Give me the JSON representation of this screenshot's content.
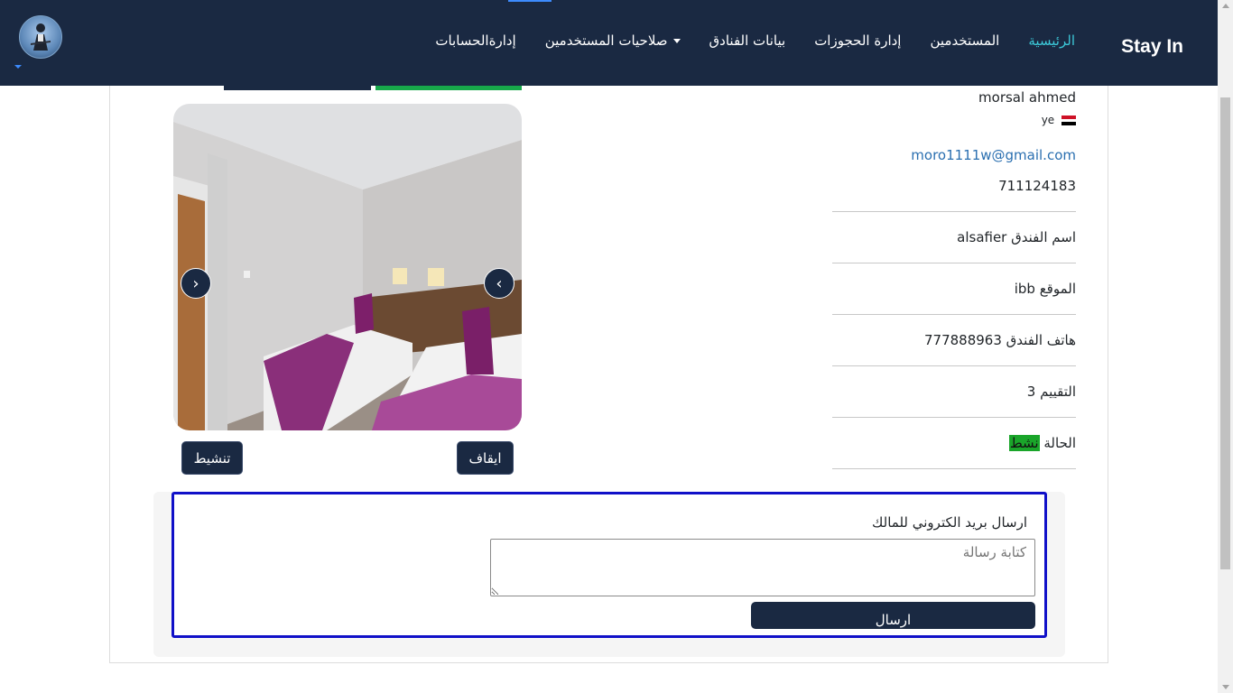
{
  "app": {
    "brand": "Stay In"
  },
  "nav": {
    "items": [
      {
        "label": "الرئيسية",
        "active": true
      },
      {
        "label": "المستخدمين"
      },
      {
        "label": "إدارة الحجوزات"
      },
      {
        "label": "بيانات الفنادق"
      },
      {
        "label": "صلاحيات المستخدمين",
        "dropdown": true
      },
      {
        "label": "إدارةالحسابات"
      }
    ]
  },
  "owner": {
    "name": "morsal ahmed",
    "country_code": "ye",
    "flag_icon": "yemen-flag-icon",
    "email": "moro1111w@gmail.com",
    "phone": "711124183"
  },
  "hotel": {
    "name_label": "اسم الفندق",
    "name": "alsafier",
    "location_label": "الموقع",
    "location": "ibb",
    "phone_label": "هاتف الفندق",
    "phone": "777888963",
    "rating_label": "التقييم",
    "rating": "3",
    "status_label": "الحالة",
    "status": "نشط"
  },
  "carousel": {
    "prev_label": "‹",
    "next_label": "›"
  },
  "actions": {
    "activate_label": "تنشيط",
    "suspend_label": "ايقاف"
  },
  "message": {
    "title": "ارسال بريد الكتروني للمالك",
    "placeholder": "كتابة رسالة",
    "send_label": "ارسال"
  },
  "colors": {
    "navbar": "#1a2942",
    "active_nav": "#3cc8d8",
    "status_badge": "#1aa52a",
    "message_border": "#1010c8",
    "email_link": "#2a6fb0"
  }
}
